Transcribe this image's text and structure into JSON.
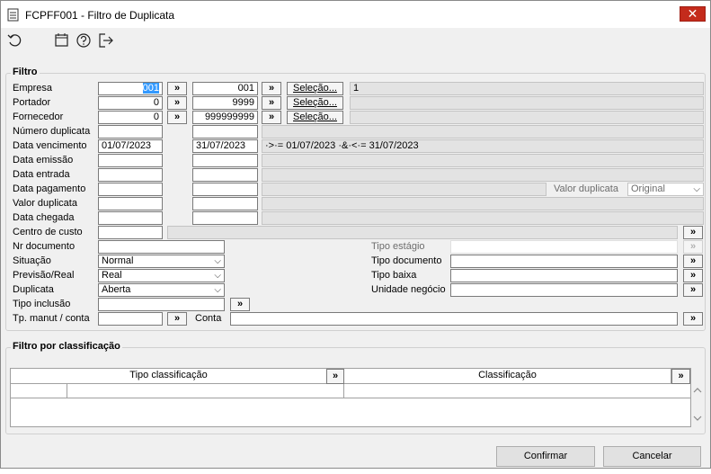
{
  "window": {
    "title": "FCPFF001 - Filtro de Duplicata",
    "close_glyph": "✕"
  },
  "toolbar": {
    "icons": [
      "refresh-icon",
      "calendar-icon",
      "help-icon",
      "exit-icon"
    ]
  },
  "filtro": {
    "group_label": "Filtro",
    "labels": {
      "empresa": "Empresa",
      "portador": "Portador",
      "fornecedor": "Fornecedor",
      "numero_duplicata": "Número duplicata",
      "data_vencimento": "Data vencimento",
      "data_emissao": "Data emissão",
      "data_entrada": "Data entrada",
      "data_pagamento": "Data pagamento",
      "valor_duplicata": "Valor duplicata",
      "data_chegada": "Data chegada",
      "centro_custo": "Centro de custo",
      "nr_documento": "Nr documento",
      "situacao": "Situação",
      "previsao_real": "Previsão/Real",
      "duplicata": "Duplicata",
      "tipo_inclusao": "Tipo inclusão",
      "tp_manut_conta": "Tp. manut / conta",
      "conta": "Conta",
      "tipo_estagio": "Tipo estágio",
      "tipo_documento": "Tipo documento",
      "tipo_baixa": "Tipo baixa",
      "unidade_negocio": "Unidade negócio",
      "valor_duplicata_right": "Valor duplicata"
    },
    "values": {
      "empresa_from": "001",
      "empresa_to": "001",
      "empresa_result": "1",
      "portador_from": "0",
      "portador_to": "9999",
      "fornecedor_from": "0",
      "fornecedor_to": "999999999",
      "venc_from": "01/07/2023",
      "venc_to": "31/07/2023",
      "venc_desc": "·>·= 01/07/2023 ·&·<·= 31/07/2023",
      "valor_dup_select": "Original",
      "situacao": "Normal",
      "previsao_real": "Real",
      "duplicata": "Aberta"
    },
    "buttons": {
      "arrow": "»",
      "selecao": "Seleção..."
    }
  },
  "classificacao": {
    "group_label": "Filtro por classificação",
    "col_tipo": "Tipo classificação",
    "col_classificacao": "Classificação",
    "arrow": "»"
  },
  "actions": {
    "confirmar": "Confirmar",
    "cancelar": "Cancelar"
  }
}
